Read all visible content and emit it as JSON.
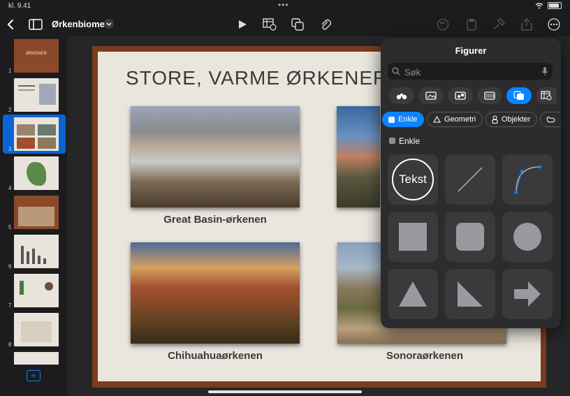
{
  "status": {
    "time": "kl. 9.41"
  },
  "toolbar": {
    "doc_title": "Ørkenbiomet"
  },
  "sidebar": {
    "slides": [
      {
        "num": "1",
        "title": "ØRKENER"
      },
      {
        "num": "2"
      },
      {
        "num": "3"
      },
      {
        "num": "4"
      },
      {
        "num": "5"
      },
      {
        "num": "6"
      },
      {
        "num": "7"
      },
      {
        "num": "8"
      }
    ]
  },
  "slide": {
    "title": "STORE, VARME ØRKENER I N",
    "captions": [
      "Great Basin-ørkenen",
      "Chihuahuaørkenen",
      "Sonoraørkenen"
    ]
  },
  "shapes_panel": {
    "title": "Figurer",
    "search_placeholder": "Søk",
    "chips": [
      "Enkle",
      "Geometri",
      "Objekter"
    ],
    "section": "Enkle",
    "text_shape_label": "Tekst"
  },
  "colors": {
    "accent": "#0a84ff",
    "panel": "#2c2c2e",
    "slide_border": "#7a3c1e"
  }
}
